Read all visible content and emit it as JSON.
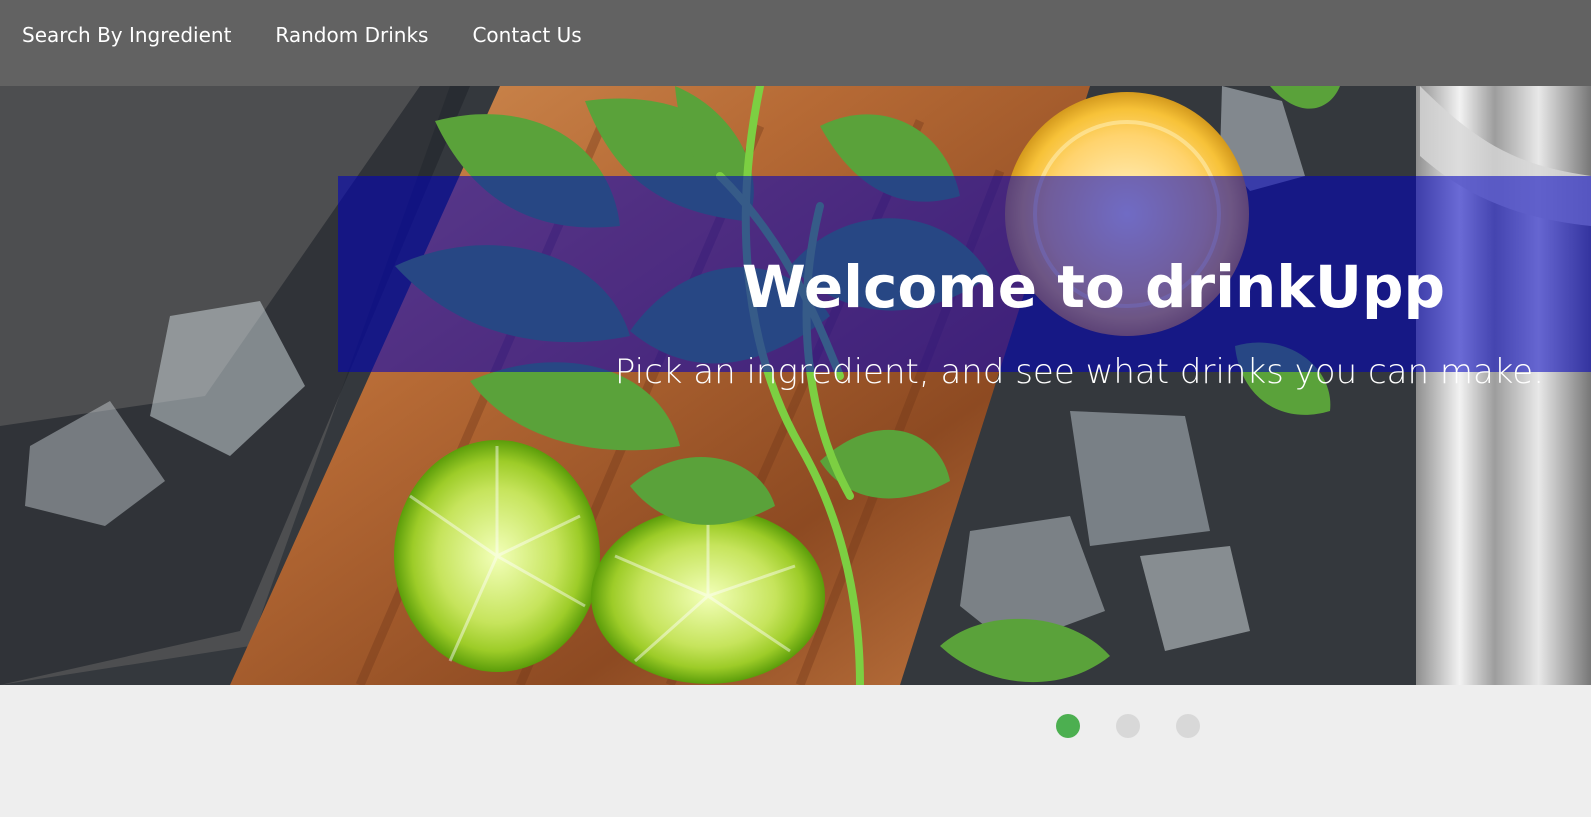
{
  "nav": {
    "items": [
      {
        "label": "Search By Ingredient"
      },
      {
        "label": "Random Drinks"
      },
      {
        "label": "Contact Us"
      }
    ]
  },
  "hero": {
    "title": "Welcome to drinkUpp",
    "subtitle": "Pick an ingredient, and see what drinks you can make.",
    "overlay_color": "#0000be",
    "image_subject": "mint leaves, sliced limes, lemon, ice cubes and cocktail shaker on a wooden board"
  },
  "carousel": {
    "active_index": 0,
    "indicator_count": 3,
    "active_color": "#4caf50",
    "inactive_color": "#d8d8d8"
  }
}
